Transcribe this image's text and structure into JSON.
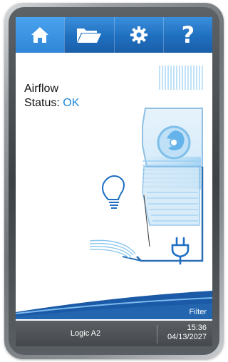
{
  "toolbar": {
    "items": [
      {
        "name": "home",
        "icon": "home-icon",
        "active": true
      },
      {
        "name": "files",
        "icon": "folder-icon",
        "active": false
      },
      {
        "name": "settings",
        "icon": "gear-icon",
        "active": false
      },
      {
        "name": "help",
        "icon": "question-icon",
        "glyph": "?",
        "active": false
      }
    ]
  },
  "main": {
    "airflow_label": "Airflow",
    "status_label": "Status: ",
    "status_value": "OK"
  },
  "icons": {
    "light": "lightbulb-icon",
    "power": "power-plug-icon"
  },
  "footer": {
    "filter_label": "Filter",
    "device_name": "Logic A2",
    "time": "15:36",
    "date": "04/13/2027"
  },
  "colors": {
    "toolbar": "#1f6fbf",
    "accent": "#1e88d8",
    "footer": "#4b4f53"
  }
}
